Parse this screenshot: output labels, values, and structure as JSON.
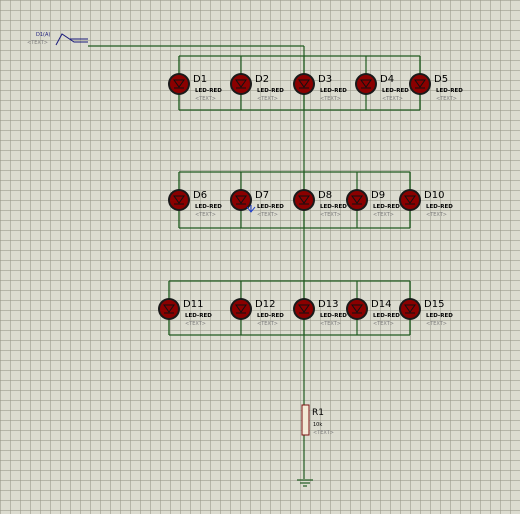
{
  "schematic": {
    "wire_color": "#1f5a1f",
    "led_body_color": "#8b0000",
    "led_ring_color": "#1a1a1a",
    "text_placeholder": "<TEXT>",
    "input_terminal": {
      "label": "D1(A)",
      "text": "<TEXT>",
      "icon": "input-terminal-icon"
    },
    "rows": [
      {
        "leds": [
          {
            "ref": "D1",
            "value": "LED-RED"
          },
          {
            "ref": "D2",
            "value": "LED-RED"
          },
          {
            "ref": "D3",
            "value": "LED-RED"
          },
          {
            "ref": "D4",
            "value": "LED-RED"
          },
          {
            "ref": "D5",
            "value": "LED-RED"
          }
        ]
      },
      {
        "leds": [
          {
            "ref": "D6",
            "value": "LED-RED"
          },
          {
            "ref": "D7",
            "value": "LED-RED"
          },
          {
            "ref": "D8",
            "value": "LED-RED"
          },
          {
            "ref": "D9",
            "value": "LED-RED"
          },
          {
            "ref": "D10",
            "value": "LED-RED"
          }
        ]
      },
      {
        "leds": [
          {
            "ref": "D11",
            "value": "LED-RED"
          },
          {
            "ref": "D12",
            "value": "LED-RED"
          },
          {
            "ref": "D13",
            "value": "LED-RED"
          },
          {
            "ref": "D14",
            "value": "LED-RED"
          },
          {
            "ref": "D15",
            "value": "LED-RED"
          }
        ]
      }
    ],
    "resistor": {
      "ref": "R1",
      "value": "10k",
      "text": "<TEXT>"
    },
    "ground": {
      "icon": "ground-icon"
    }
  }
}
